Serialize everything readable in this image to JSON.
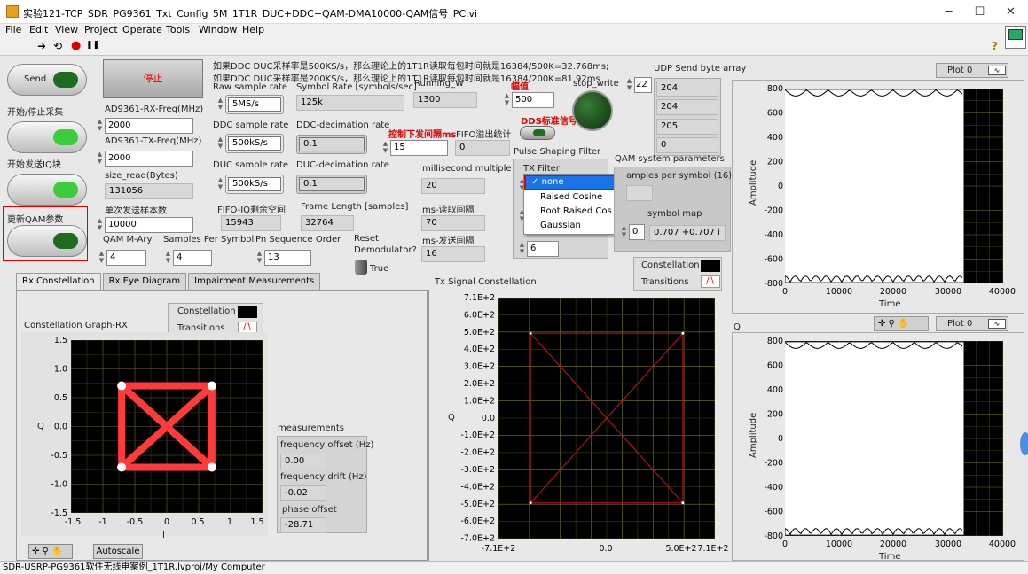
{
  "window": {
    "title": "实验121-TCP_SDR_PG9361_Txt_Config_5M_1T1R_DUC+DDC+QAM-DMA10000-QAM信号_PC.vi",
    "minimize": "─",
    "maximize": "☐",
    "close": "✕"
  },
  "menu": [
    "File",
    "Edit",
    "View",
    "Project",
    "Operate",
    "Tools",
    "Window",
    "Help"
  ],
  "toolbar": {
    "run": "➜",
    "run_cont": "⟲",
    "abort": "●",
    "pause": "❚❚",
    "help": "?"
  },
  "notes": {
    "line1": "如果DDC DUC采样率是500KS/s，那么理论上的1T1R读取每包时间就是16384/500K=32.768ms;",
    "line2": "如果DDC DUC采样率是200KS/s，那么理论上的1T1R读取每包时间就是16384/200K=81.92ms"
  },
  "buttons": {
    "send": "Send",
    "send_caption": "开始/停止采集",
    "stop": "停止",
    "tx_caption": "开始发送IQ块",
    "update_caption": "更新QAM参数"
  },
  "fields": {
    "rx_freq_label": "AD9361-RX-Freq(MHz)",
    "rx_freq": "2000",
    "tx_freq_label": "AD9361-TX-Freq(MHz)",
    "tx_freq": "2000",
    "size_read_label": "size_read(Bytes)",
    "size_read": "131056",
    "send_samples_label": "单次发送样本数",
    "send_samples": "10000",
    "raw_rate_label": "Raw sample rate",
    "raw_rate": "5MS/s",
    "ddc_rate_label": "DDC sample rate",
    "ddc_rate": "500kS/s",
    "duc_rate_label": "DUC sample rate",
    "duc_rate": "500kS/s",
    "fifo_label": "FIFO-IQ剩余空间",
    "fifo": "15943",
    "symbol_rate_label": "Symbol Rate [symbols/sec]",
    "symbol_rate": "125k",
    "ddc_dec_label": "DDC-decimation rate",
    "ddc_dec": "0.1",
    "duc_dec_label": "DUC-decimation rate",
    "duc_dec": "0.1",
    "frame_len_label": "Frame Length [samples]",
    "frame_len": "32764",
    "running_w_label": "Running_W",
    "running_w": "1300",
    "ctrl_interval_label": "控制下发间隔ms",
    "ctrl_interval": "15",
    "fifo_overflow_label": "FIFO溢出统计",
    "fifo_overflow": "0",
    "ms_mult_label": "millisecond multiple",
    "ms_mult": "20",
    "ms_read_label": "ms-读取间隔",
    "ms_read": "70",
    "ms_send_label": "ms-发送间隔",
    "ms_send": "16",
    "amplitude_label": "幅值",
    "amplitude": "500",
    "stop_write_label": "stop_write",
    "dds_label": "DDS标准信号",
    "pulse_label": "Pulse Shaping Filter",
    "tx_filter_label": "TX Filter",
    "filter_param": "6",
    "qam_m_label": "QAM M-Ary",
    "qam_m": "4",
    "sps_label": "Samples Per Symbol",
    "sps": "4",
    "pn_label": "Pn Sequence Order",
    "pn": "13",
    "reset_label": "Reset",
    "demod_label": "Demodulator?",
    "reset_val": "True",
    "udp_label": "UDP Send byte array",
    "udp_index": "22",
    "udp_values": [
      "204",
      "204",
      "205",
      "0"
    ],
    "qam_sys_label": "QAM system parameters",
    "sps16_label": "amples per symbol (16)",
    "symmap_label": "symbol map",
    "symmap_index": "0",
    "symmap_val": "0.707 +0.707 i"
  },
  "dropdown": {
    "items": [
      "none",
      "Raised Cosine",
      "Root Raised Cos",
      "Gaussian"
    ],
    "selected": "none"
  },
  "tabs": [
    "Rx Constellation",
    "Rx Eye Diagram",
    "Impairment Measurements"
  ],
  "rx_graph": {
    "title": "Constellation Graph-RX",
    "legend": [
      "Constellation",
      "Transitions"
    ],
    "ylabel": "Q",
    "xlabel": "I",
    "autoscale": "Autoscale"
  },
  "measurements": {
    "title": "measurements",
    "freq_off_label": "frequency offset (Hz)",
    "freq_off": "0.00",
    "freq_drift_label": "frequency drift (Hz)",
    "freq_drift": "-0.02",
    "phase_label": "phase offset",
    "phase": "-28.71"
  },
  "tx_graph": {
    "title": "Tx Signal Constellation",
    "legend": [
      "Constellation",
      "Transitions"
    ],
    "ylabel": "Q"
  },
  "right_graphs": {
    "plot_label": "Plot 0",
    "ylabel": "Amplitude",
    "xlabel": "Time",
    "q_label": "Q"
  },
  "status": "SDR-USRP-PG9361软件无线电案例_1T1R.lvproj/My Computer",
  "chart_data": [
    {
      "type": "scatter",
      "title": "Constellation Graph-RX",
      "xlabel": "I",
      "ylabel": "Q",
      "xlim": [
        -1.5,
        1.5
      ],
      "ylim": [
        -1.5,
        1.5
      ],
      "xticks": [
        "-1.5",
        "-1",
        "-0.5",
        "0",
        "0.5",
        "1",
        "1.5"
      ],
      "yticks": [
        "1.5",
        "1.0",
        "0.5",
        "0.0",
        "-0.5",
        "-1.0",
        "-1.5"
      ],
      "points": [
        [
          -0.707,
          0.707
        ],
        [
          0.707,
          0.707
        ],
        [
          -0.707,
          -0.707
        ],
        [
          0.707,
          -0.707
        ]
      ],
      "series": [
        {
          "name": "Constellation"
        },
        {
          "name": "Transitions"
        }
      ],
      "color": "#ff3a3a"
    },
    {
      "type": "scatter",
      "title": "Tx Signal Constellation",
      "ylabel": "Q",
      "xlim": [
        -710,
        710
      ],
      "ylim": [
        -710,
        710
      ],
      "xticks": [
        "-7.1E+2",
        "0.0",
        "5.0E+2",
        "7.1E+2"
      ],
      "yticks": [
        "7.1E+2",
        "6.0E+2",
        "5.0E+2",
        "4.0E+2",
        "3.0E+2",
        "2.0E+2",
        "1.0E+2",
        "0.0",
        "-1.0E+2",
        "-2.0E+2",
        "-3.0E+2",
        "-4.0E+2",
        "-5.0E+2",
        "-6.0E+2",
        "-7.0E+2"
      ],
      "points": [
        [
          -500,
          500
        ],
        [
          500,
          500
        ],
        [
          -500,
          -500
        ],
        [
          500,
          -500
        ]
      ],
      "color": "#d01010"
    },
    {
      "type": "line",
      "series": [
        {
          "name": "Plot 0"
        }
      ],
      "xlabel": "Time",
      "ylabel": "Amplitude",
      "xlim": [
        0,
        40000
      ],
      "ylim": [
        -800,
        800
      ],
      "xticks": [
        "0",
        "10000",
        "20000",
        "30000",
        "40000"
      ],
      "yticks": [
        "800",
        "600",
        "400",
        "200",
        "0",
        "-200",
        "-400",
        "-600",
        "-800"
      ],
      "envelope": {
        "x_end": 32764,
        "upper": 790,
        "lower": -790
      }
    },
    {
      "type": "line",
      "series": [
        {
          "name": "Plot 0"
        }
      ],
      "xlabel": "Time",
      "ylabel": "Amplitude",
      "xlim": [
        0,
        40000
      ],
      "ylim": [
        -800,
        800
      ],
      "xticks": [
        "0",
        "10000",
        "20000",
        "30000",
        "40000"
      ],
      "yticks": [
        "800",
        "600",
        "400",
        "200",
        "0",
        "-200",
        "-400",
        "-600",
        "-800"
      ],
      "envelope": {
        "x_end": 32764,
        "upper": 790,
        "lower": -790
      }
    }
  ]
}
